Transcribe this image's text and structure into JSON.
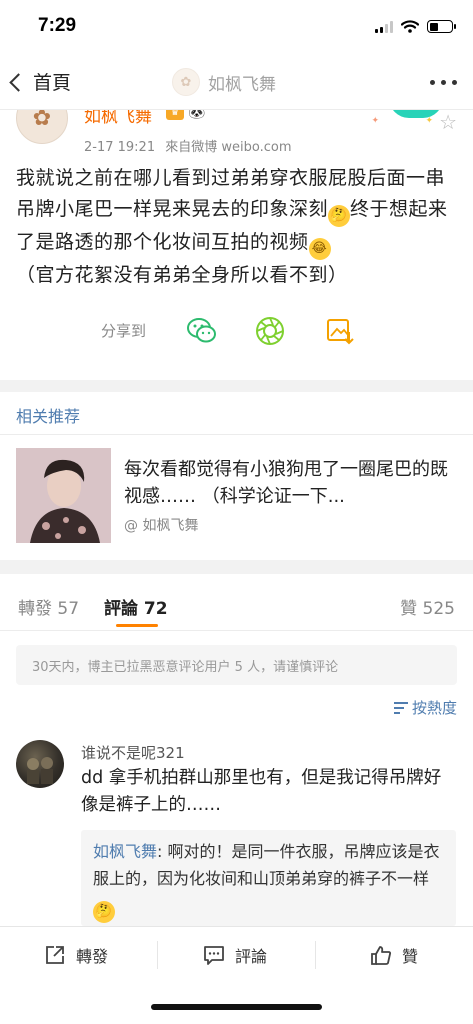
{
  "status_bar": {
    "time": "7:29"
  },
  "nav": {
    "back_label": "首頁",
    "title": "如枫飞舞"
  },
  "post": {
    "author": "如枫飞舞",
    "date": "2-17 19:21",
    "source": "來自微博 weibo.com",
    "text_part1": "我就说之前在哪儿看到过弟弟穿衣服屁股后面一串吊牌小尾巴一样晃来晃去的印象深刻",
    "text_part2": "终于想起来了是路透的那个化妆间互拍的视频",
    "text_part3": "（官方花絮没有弟弟全身所以看不到）",
    "share_label": "分享到"
  },
  "related": {
    "title": "相关推荐",
    "item_text": "每次看都觉得有小狼狗甩了一圈尾巴的既视感…… （科学论证一下...",
    "item_author": "@ 如枫飞舞"
  },
  "tabs": {
    "repost_label": "轉發",
    "repost_count": "57",
    "comment_label": "評論",
    "comment_count": "72",
    "like_label": "贊",
    "like_count": "525"
  },
  "notice": "30天内，博主已拉黑恶意评论用户 5 人，请谨慎评论",
  "sort_label": "按熱度",
  "comment": {
    "user": "谁说不是呢321",
    "text": "dd 拿手机拍群山那里也有，但是我记得吊牌好像是裤子上的……",
    "reply_user": "如枫飞舞",
    "reply_text": ": 啊对的！是同一件衣服，吊牌应该是衣服上的，因为化妆间和山顶弟弟穿的裤子不一样"
  },
  "bottom_bar": {
    "repost": "轉發",
    "comment": "評論",
    "like": "贊"
  },
  "colors": {
    "accent": "#ff8200",
    "link": "#507daf",
    "author": "#f56a00"
  }
}
